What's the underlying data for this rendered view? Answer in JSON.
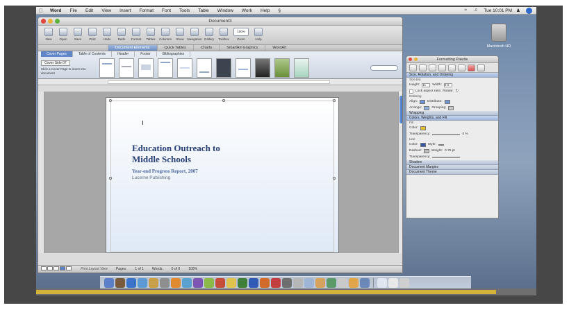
{
  "menubar": {
    "app": "Word",
    "menus": [
      "File",
      "Edit",
      "View",
      "Insert",
      "Format",
      "Font",
      "Tools",
      "Table",
      "Window",
      "Work",
      "Help"
    ],
    "clock": "Tue 10:01 PM"
  },
  "desktop": {
    "hd_label": "Macintosh HD"
  },
  "window": {
    "title": "Document3",
    "toolbar": [
      "New",
      "Open",
      "Save",
      "Print",
      "Undo",
      "Redo",
      "Format",
      "Tables",
      "Columns",
      "Show",
      "Navigation",
      "Gallery",
      "Toolbox",
      "Zoom",
      "Help"
    ],
    "zoom": "100%"
  },
  "ribbon": {
    "tabs": [
      "Document Elements",
      "Quick Tables",
      "Charts",
      "SmartArt Graphics",
      "WordArt"
    ],
    "active_tab": "Document Elements"
  },
  "gallery": {
    "tabs": [
      "Cover Pages",
      "Table of Contents",
      "Header",
      "Footer",
      "Bibliographies"
    ],
    "active_tab": "Cover Pages",
    "selector": "Cover Side 07",
    "hint": "Click a Cover Page to insert into document"
  },
  "document": {
    "title_line1": "Education Outreach to",
    "title_line2": "Middle Schools",
    "subtitle": "Year-end Progress Report, 2007",
    "company": "Lucerne Publishing"
  },
  "statusbar": {
    "view": "Print Layout View",
    "pages_label": "Pages:",
    "pages": "1 of 1",
    "words_label": "Words:",
    "words": "0 of 0",
    "zoom": "100%"
  },
  "palette": {
    "title": "Formatting Palette",
    "sections": {
      "size_rotation": "Size, Rotation, and Ordering",
      "size": "Size (in)",
      "height_label": "Height:",
      "height": "11",
      "width_label": "Width:",
      "width": "8.5",
      "lock_label": "Lock aspect ratio",
      "rotate_label": "Rotate:",
      "ordering": "Ordering",
      "align_label": "Align:",
      "distribute_label": "Distribute:",
      "arrange_label": "Arrange:",
      "grouping_label": "Grouping:",
      "wrapping": "Wrapping",
      "colors_weights": "Colors, Weights, and Fill",
      "fill": "Fill",
      "color_label": "Color:",
      "transparency_label": "Transparency:",
      "transparency_value": "0 %",
      "line": "Line",
      "style_label": "Style:",
      "dashed_label": "Dashed:",
      "weight_label": "Weight:",
      "weight_value": "0.75 pt",
      "shadow": "Shadow",
      "doc_margins": "Document Margins",
      "doc_theme": "Document Theme"
    }
  },
  "video": {
    "progress_fraction": 0.92
  }
}
